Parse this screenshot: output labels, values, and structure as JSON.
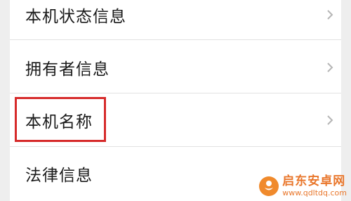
{
  "settings": {
    "items": [
      {
        "label": "本机状态信息"
      },
      {
        "label": "拥有者信息"
      },
      {
        "label": "本机名称"
      },
      {
        "label": "法律信息"
      }
    ]
  },
  "watermark": {
    "title": "启东安卓网",
    "url": "www.qdltdq.com"
  },
  "colors": {
    "highlight": "#d62a2a",
    "watermark": "#e9772c"
  }
}
